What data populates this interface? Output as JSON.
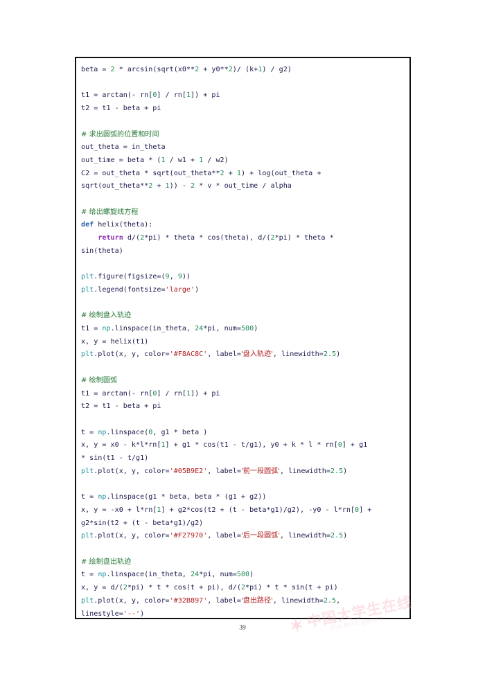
{
  "document": {
    "page_number": "39",
    "watermark": {
      "star_glyph": "✶",
      "title": "中国大学生在线",
      "url": "dxs.moe.gov.cn"
    }
  },
  "code_block": {
    "language": "python",
    "colors": {
      "text": "#1a1a4e",
      "number": "#1a8a52",
      "string": "#b02020",
      "comment": "#2a7a3a",
      "keyword": "#2c5fa8",
      "return_keyword": "#8b2fb5",
      "module": "#1f8fa0",
      "border": "#111111",
      "background": "#ffffff"
    },
    "lines": [
      {
        "tokens": [
          {
            "t": "beta = ",
            "c": "plain"
          },
          {
            "t": "2",
            "c": "num"
          },
          {
            "t": " * arcsin(sqrt(x0**",
            "c": "plain"
          },
          {
            "t": "2",
            "c": "num"
          },
          {
            "t": " + y0**",
            "c": "plain"
          },
          {
            "t": "2",
            "c": "num"
          },
          {
            "t": ")/ (k+",
            "c": "plain"
          },
          {
            "t": "1",
            "c": "num"
          },
          {
            "t": ") / g2)",
            "c": "plain"
          }
        ]
      },
      {
        "tokens": []
      },
      {
        "tokens": [
          {
            "t": "t1 = arctan(- rn[",
            "c": "plain"
          },
          {
            "t": "0",
            "c": "num"
          },
          {
            "t": "] / rn[",
            "c": "plain"
          },
          {
            "t": "1",
            "c": "num"
          },
          {
            "t": "]) + pi",
            "c": "plain"
          }
        ]
      },
      {
        "tokens": [
          {
            "t": "t2 = t1 - beta + pi",
            "c": "plain"
          }
        ]
      },
      {
        "tokens": []
      },
      {
        "tokens": [
          {
            "t": "# 求出圆弧的位置和时间",
            "c": "cmt"
          }
        ]
      },
      {
        "tokens": [
          {
            "t": "out_theta = in_theta",
            "c": "plain"
          }
        ]
      },
      {
        "tokens": [
          {
            "t": "out_time = beta * (",
            "c": "plain"
          },
          {
            "t": "1",
            "c": "num"
          },
          {
            "t": " / w1 + ",
            "c": "plain"
          },
          {
            "t": "1",
            "c": "num"
          },
          {
            "t": " / w2)",
            "c": "plain"
          }
        ]
      },
      {
        "tokens": [
          {
            "t": "C2 = out_theta * sqrt(out_theta**",
            "c": "plain"
          },
          {
            "t": "2",
            "c": "num"
          },
          {
            "t": " + ",
            "c": "plain"
          },
          {
            "t": "1",
            "c": "num"
          },
          {
            "t": ") + log(out_theta +",
            "c": "plain"
          }
        ]
      },
      {
        "tokens": [
          {
            "t": "sqrt(out_theta**",
            "c": "plain"
          },
          {
            "t": "2",
            "c": "num"
          },
          {
            "t": " + ",
            "c": "plain"
          },
          {
            "t": "1",
            "c": "num"
          },
          {
            "t": ")) - ",
            "c": "plain"
          },
          {
            "t": "2",
            "c": "num"
          },
          {
            "t": " * v * out_time / alpha",
            "c": "plain"
          }
        ]
      },
      {
        "tokens": []
      },
      {
        "tokens": [
          {
            "t": "# 给出螺旋线方程",
            "c": "cmt"
          }
        ]
      },
      {
        "tokens": [
          {
            "t": "def",
            "c": "kw"
          },
          {
            "t": " helix(theta):",
            "c": "plain"
          }
        ]
      },
      {
        "tokens": [
          {
            "t": "    ",
            "c": "plain"
          },
          {
            "t": "return",
            "c": "ret"
          },
          {
            "t": " d/(",
            "c": "plain"
          },
          {
            "t": "2",
            "c": "num"
          },
          {
            "t": "*pi) * theta * cos(theta), d/(",
            "c": "plain"
          },
          {
            "t": "2",
            "c": "num"
          },
          {
            "t": "*pi) * theta *",
            "c": "plain"
          }
        ]
      },
      {
        "tokens": [
          {
            "t": "sin(theta)",
            "c": "plain"
          }
        ]
      },
      {
        "tokens": []
      },
      {
        "tokens": [
          {
            "t": "plt",
            "c": "mod"
          },
          {
            "t": ".figure(figsize=(",
            "c": "plain"
          },
          {
            "t": "9",
            "c": "num"
          },
          {
            "t": ", ",
            "c": "plain"
          },
          {
            "t": "9",
            "c": "num"
          },
          {
            "t": "))",
            "c": "plain"
          }
        ]
      },
      {
        "tokens": [
          {
            "t": "plt",
            "c": "mod"
          },
          {
            "t": ".legend(fontsize=",
            "c": "plain"
          },
          {
            "t": "'large'",
            "c": "str"
          },
          {
            "t": ")",
            "c": "plain"
          }
        ]
      },
      {
        "tokens": []
      },
      {
        "tokens": [
          {
            "t": "# 绘制盘入轨迹",
            "c": "cmt"
          }
        ]
      },
      {
        "tokens": [
          {
            "t": "t1 = ",
            "c": "plain"
          },
          {
            "t": "np",
            "c": "mod"
          },
          {
            "t": ".linspace(in_theta, ",
            "c": "plain"
          },
          {
            "t": "24",
            "c": "num"
          },
          {
            "t": "*pi, num=",
            "c": "plain"
          },
          {
            "t": "500",
            "c": "num"
          },
          {
            "t": ")",
            "c": "plain"
          }
        ]
      },
      {
        "tokens": [
          {
            "t": "x, y = helix(t1)",
            "c": "plain"
          }
        ]
      },
      {
        "tokens": [
          {
            "t": "plt",
            "c": "mod"
          },
          {
            "t": ".plot(x, y, color=",
            "c": "plain"
          },
          {
            "t": "'#F8AC8C'",
            "c": "str"
          },
          {
            "t": ", label=",
            "c": "plain"
          },
          {
            "t": "'盘入轨迹'",
            "c": "str"
          },
          {
            "t": ", linewidth=",
            "c": "plain"
          },
          {
            "t": "2.5",
            "c": "num"
          },
          {
            "t": ")",
            "c": "plain"
          }
        ]
      },
      {
        "tokens": []
      },
      {
        "tokens": [
          {
            "t": "# 绘制圆弧",
            "c": "cmt"
          }
        ]
      },
      {
        "tokens": [
          {
            "t": "t1 = arctan(- rn[",
            "c": "plain"
          },
          {
            "t": "0",
            "c": "num"
          },
          {
            "t": "] / rn[",
            "c": "plain"
          },
          {
            "t": "1",
            "c": "num"
          },
          {
            "t": "]) + pi",
            "c": "plain"
          }
        ]
      },
      {
        "tokens": [
          {
            "t": "t2 = t1 - beta + pi",
            "c": "plain"
          }
        ]
      },
      {
        "tokens": []
      },
      {
        "tokens": [
          {
            "t": "t = ",
            "c": "plain"
          },
          {
            "t": "np",
            "c": "mod"
          },
          {
            "t": ".linspace(",
            "c": "plain"
          },
          {
            "t": "0",
            "c": "num"
          },
          {
            "t": ", g1 * beta )",
            "c": "plain"
          }
        ]
      },
      {
        "tokens": [
          {
            "t": "x, y = x0 - k*l*rn[",
            "c": "plain"
          },
          {
            "t": "1",
            "c": "num"
          },
          {
            "t": "] + g1 * cos(t1 - t/g1), y0 + k * l * rn[",
            "c": "plain"
          },
          {
            "t": "0",
            "c": "num"
          },
          {
            "t": "] + g1",
            "c": "plain"
          }
        ]
      },
      {
        "tokens": [
          {
            "t": "* sin(t1 - t/g1)",
            "c": "plain"
          }
        ]
      },
      {
        "tokens": [
          {
            "t": "plt",
            "c": "mod"
          },
          {
            "t": ".plot(x, y, color=",
            "c": "plain"
          },
          {
            "t": "'#05B9E2'",
            "c": "str"
          },
          {
            "t": ", label=",
            "c": "plain"
          },
          {
            "t": "'前一段圆弧'",
            "c": "str"
          },
          {
            "t": ", linewidth=",
            "c": "plain"
          },
          {
            "t": "2.5",
            "c": "num"
          },
          {
            "t": ")",
            "c": "plain"
          }
        ]
      },
      {
        "tokens": []
      },
      {
        "tokens": [
          {
            "t": "t = ",
            "c": "plain"
          },
          {
            "t": "np",
            "c": "mod"
          },
          {
            "t": ".linspace(g1 * beta, beta * (g1 + g2))",
            "c": "plain"
          }
        ]
      },
      {
        "tokens": [
          {
            "t": "x, y = -x0 + l*rn[",
            "c": "plain"
          },
          {
            "t": "1",
            "c": "num"
          },
          {
            "t": "] + g2*cos(t2 + (t - beta*g1)/g2), -y0 - l*rn[",
            "c": "plain"
          },
          {
            "t": "0",
            "c": "num"
          },
          {
            "t": "] +",
            "c": "plain"
          }
        ]
      },
      {
        "tokens": [
          {
            "t": "g2*sin(t2 + (t - beta*g1)/g2)",
            "c": "plain"
          }
        ]
      },
      {
        "tokens": [
          {
            "t": "plt",
            "c": "mod"
          },
          {
            "t": ".plot(x, y, color=",
            "c": "plain"
          },
          {
            "t": "'#F27970'",
            "c": "str"
          },
          {
            "t": ", label=",
            "c": "plain"
          },
          {
            "t": "'后一段圆弧'",
            "c": "str"
          },
          {
            "t": ", linewidth=",
            "c": "plain"
          },
          {
            "t": "2.5",
            "c": "num"
          },
          {
            "t": ")",
            "c": "plain"
          }
        ]
      },
      {
        "tokens": []
      },
      {
        "tokens": [
          {
            "t": "# 绘制盘出轨迹",
            "c": "cmt"
          }
        ]
      },
      {
        "tokens": [
          {
            "t": "t = ",
            "c": "plain"
          },
          {
            "t": "np",
            "c": "mod"
          },
          {
            "t": ".linspace(in_theta, ",
            "c": "plain"
          },
          {
            "t": "24",
            "c": "num"
          },
          {
            "t": "*pi, num=",
            "c": "plain"
          },
          {
            "t": "500",
            "c": "num"
          },
          {
            "t": ")",
            "c": "plain"
          }
        ]
      },
      {
        "tokens": [
          {
            "t": "x, y = d/(",
            "c": "plain"
          },
          {
            "t": "2",
            "c": "num"
          },
          {
            "t": "*pi) * t * cos(t + pi), d/(",
            "c": "plain"
          },
          {
            "t": "2",
            "c": "num"
          },
          {
            "t": "*pi) * t * sin(t + pi)",
            "c": "plain"
          }
        ]
      },
      {
        "tokens": [
          {
            "t": "plt",
            "c": "mod"
          },
          {
            "t": ".plot(x, y, color=",
            "c": "plain"
          },
          {
            "t": "'#32B897'",
            "c": "str"
          },
          {
            "t": ", label=",
            "c": "plain"
          },
          {
            "t": "'盘出路径'",
            "c": "str"
          },
          {
            "t": ", linewidth=",
            "c": "plain"
          },
          {
            "t": "2.5",
            "c": "num"
          },
          {
            "t": ",",
            "c": "plain"
          }
        ]
      },
      {
        "tokens": [
          {
            "t": "linestyle=",
            "c": "plain"
          },
          {
            "t": "'--'",
            "c": "str"
          },
          {
            "t": ")",
            "c": "plain"
          }
        ]
      }
    ]
  }
}
